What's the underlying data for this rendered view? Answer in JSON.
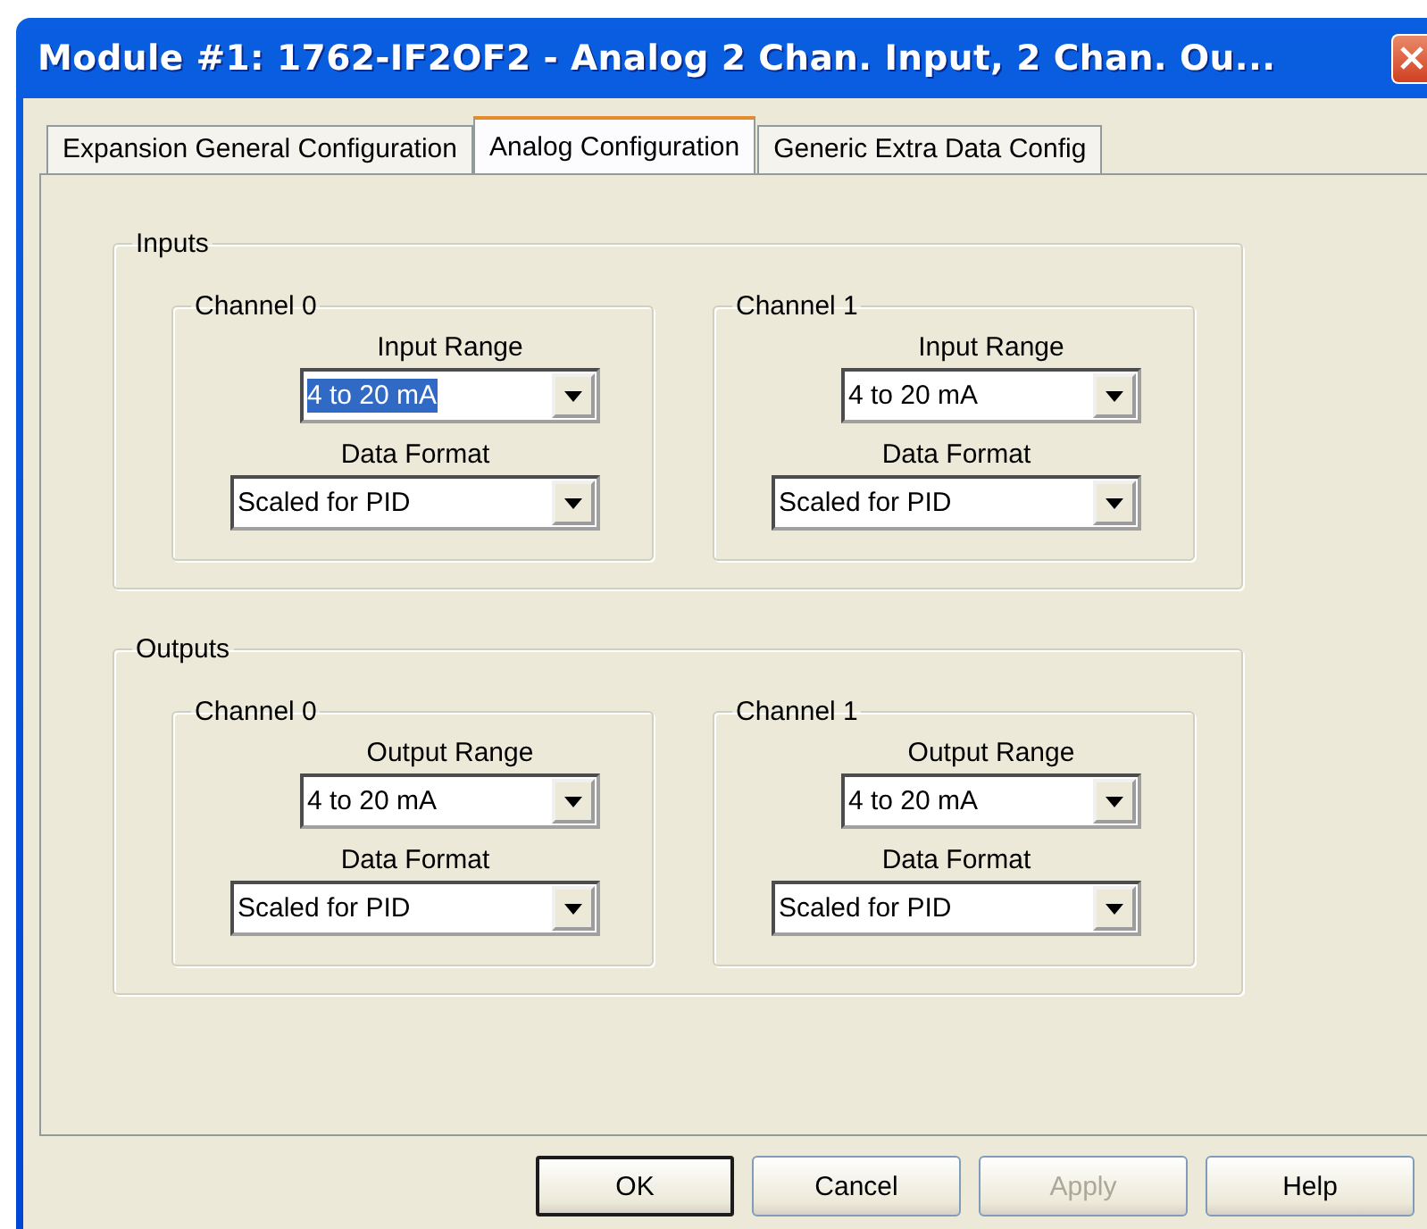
{
  "window": {
    "title": "Module #1: 1762-IF2OF2 - Analog 2 Chan. Input, 2 Chan. Ou..."
  },
  "tabs": [
    {
      "label": "Expansion General Configuration",
      "selected": false
    },
    {
      "label": "Analog Configuration",
      "selected": true
    },
    {
      "label": "Generic Extra Data Config",
      "selected": false
    }
  ],
  "groups": [
    {
      "title": "Inputs",
      "channels": [
        {
          "title": "Channel 0",
          "range_label": "Input Range",
          "range": {
            "value": "4 to 20 mA",
            "selected": true
          },
          "format_label": "Data Format",
          "format": {
            "value": "Scaled for PID",
            "selected": false
          }
        },
        {
          "title": "Channel 1",
          "range_label": "Input Range",
          "range": {
            "value": "4 to 20 mA",
            "selected": false
          },
          "format_label": "Data Format",
          "format": {
            "value": "Scaled for PID",
            "selected": false
          }
        }
      ]
    },
    {
      "title": "Outputs",
      "channels": [
        {
          "title": "Channel 0",
          "range_label": "Output Range",
          "range": {
            "value": "4 to 20 mA",
            "selected": false
          },
          "format_label": "Data Format",
          "format": {
            "value": "Scaled for PID",
            "selected": false
          }
        },
        {
          "title": "Channel 1",
          "range_label": "Output Range",
          "range": {
            "value": "4 to 20 mA",
            "selected": false
          },
          "format_label": "Data Format",
          "format": {
            "value": "Scaled for PID",
            "selected": false
          }
        }
      ]
    }
  ],
  "buttons": [
    {
      "label": "OK",
      "default": true,
      "disabled": false
    },
    {
      "label": "Cancel",
      "default": false,
      "disabled": false
    },
    {
      "label": "Apply",
      "default": false,
      "disabled": true
    },
    {
      "label": "Help",
      "default": false,
      "disabled": false
    }
  ]
}
